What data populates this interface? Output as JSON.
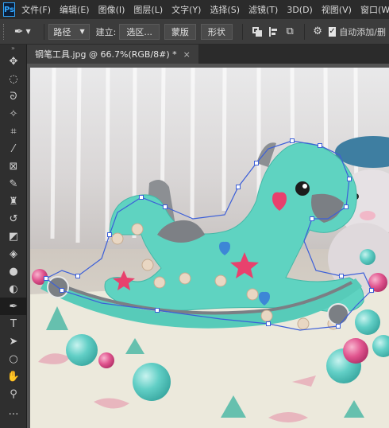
{
  "menu": {
    "logo": "Ps",
    "items": [
      "文件(F)",
      "编辑(E)",
      "图像(I)",
      "图层(L)",
      "文字(Y)",
      "选择(S)",
      "滤镜(T)",
      "3D(D)",
      "视图(V)",
      "窗口(W)"
    ]
  },
  "options": {
    "mode": "路径",
    "build_label": "建立:",
    "selection": "选区...",
    "mask": "蒙版",
    "shape": "形状",
    "auto_add_label": "自动添加/删"
  },
  "document": {
    "tab_title": "钢笔工具.jpg @ 66.7%(RGB/8#) *",
    "close": "×"
  },
  "tools": [
    {
      "name": "move-tool",
      "glyph": "✥"
    },
    {
      "name": "marquee-tool",
      "glyph": "◌"
    },
    {
      "name": "lasso-tool",
      "glyph": "ᘐ"
    },
    {
      "name": "magic-wand-tool",
      "glyph": "✧"
    },
    {
      "name": "crop-tool",
      "glyph": "⌗"
    },
    {
      "name": "eyedropper-tool",
      "glyph": "⁄"
    },
    {
      "name": "frame-tool",
      "glyph": "⊠"
    },
    {
      "name": "brush-tool",
      "glyph": "✎"
    },
    {
      "name": "stamp-tool",
      "glyph": "♜"
    },
    {
      "name": "history-brush-tool",
      "glyph": "↺"
    },
    {
      "name": "eraser-tool",
      "glyph": "◩"
    },
    {
      "name": "paint-bucket-tool",
      "glyph": "◈"
    },
    {
      "name": "blur-tool",
      "glyph": "●"
    },
    {
      "name": "dodge-tool",
      "glyph": "◐"
    },
    {
      "name": "pen-tool",
      "glyph": "✒"
    },
    {
      "name": "type-tool",
      "glyph": "T"
    },
    {
      "name": "path-select-tool",
      "glyph": "➤"
    },
    {
      "name": "ellipse-tool",
      "glyph": "○"
    },
    {
      "name": "hand-tool",
      "glyph": "✋"
    },
    {
      "name": "zoom-tool",
      "glyph": "⚲"
    },
    {
      "name": "more-tools",
      "glyph": "…"
    }
  ],
  "colors": {
    "horse": "#5fd3c1",
    "path": "#3c5fd8"
  }
}
